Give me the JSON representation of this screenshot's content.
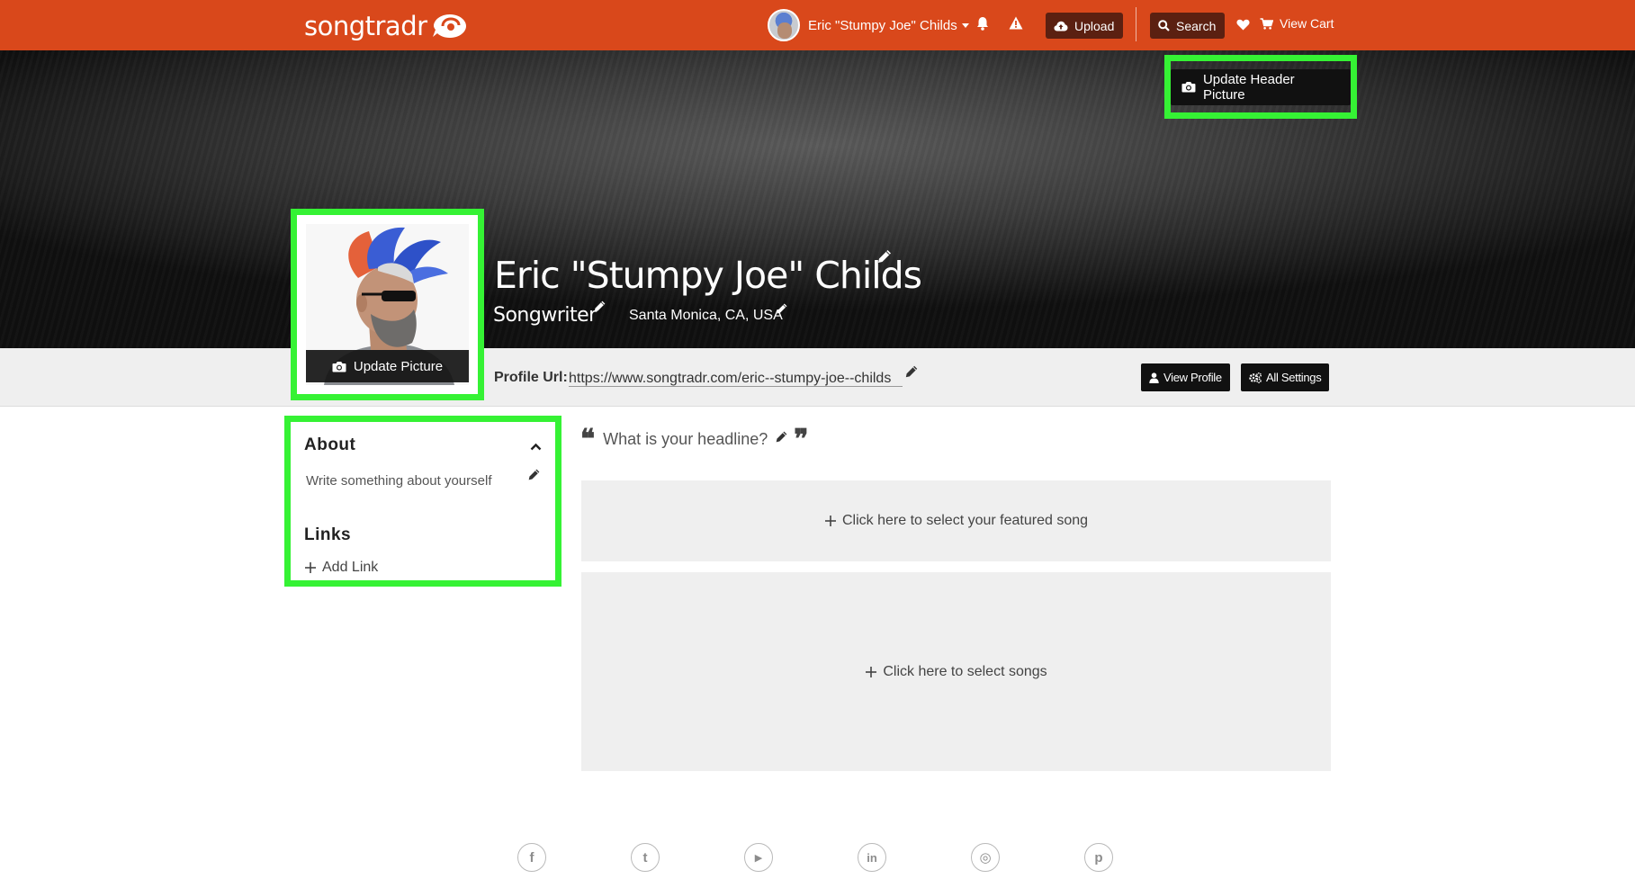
{
  "nav": {
    "logo_text": "songtradr",
    "user_name": "Eric \"Stumpy Joe\" Childs",
    "upload_label": "Upload",
    "search_label": "Search",
    "view_cart_label": "View Cart"
  },
  "banner": {
    "update_header_label": "Update Header Picture"
  },
  "profile": {
    "name": "Eric \"Stumpy Joe\" Childs",
    "role": "Songwriter",
    "location": "Santa Monica, CA, USA",
    "update_picture_label": "Update Picture",
    "url_label": "Profile Url:",
    "url_value": "https://www.songtradr.com/eric--stumpy-joe--childs",
    "view_profile_label": "View Profile",
    "all_settings_label": "All Settings"
  },
  "sidebar": {
    "about_title": "About",
    "about_placeholder": "Write something about yourself",
    "links_title": "Links",
    "add_link_label": "Add Link"
  },
  "main": {
    "headline_placeholder": "What is your headline?",
    "open_quote": "❝",
    "close_quote": "❞",
    "featured_song_label": "Click here to select your featured song",
    "select_songs_label": "Click here to select songs"
  },
  "footer": {
    "social": [
      {
        "icon": "facebook-icon",
        "glyph": "f"
      },
      {
        "icon": "twitter-icon",
        "glyph": "t"
      },
      {
        "icon": "youtube-icon",
        "glyph": "▶"
      },
      {
        "icon": "linkedin-icon",
        "glyph": "in"
      },
      {
        "icon": "instagram-icon",
        "glyph": "◎"
      },
      {
        "icon": "pinterest-icon",
        "glyph": "p"
      }
    ]
  },
  "colors": {
    "brand": "#d9481b",
    "highlight": "#35f234",
    "dark_button": "#111111"
  }
}
